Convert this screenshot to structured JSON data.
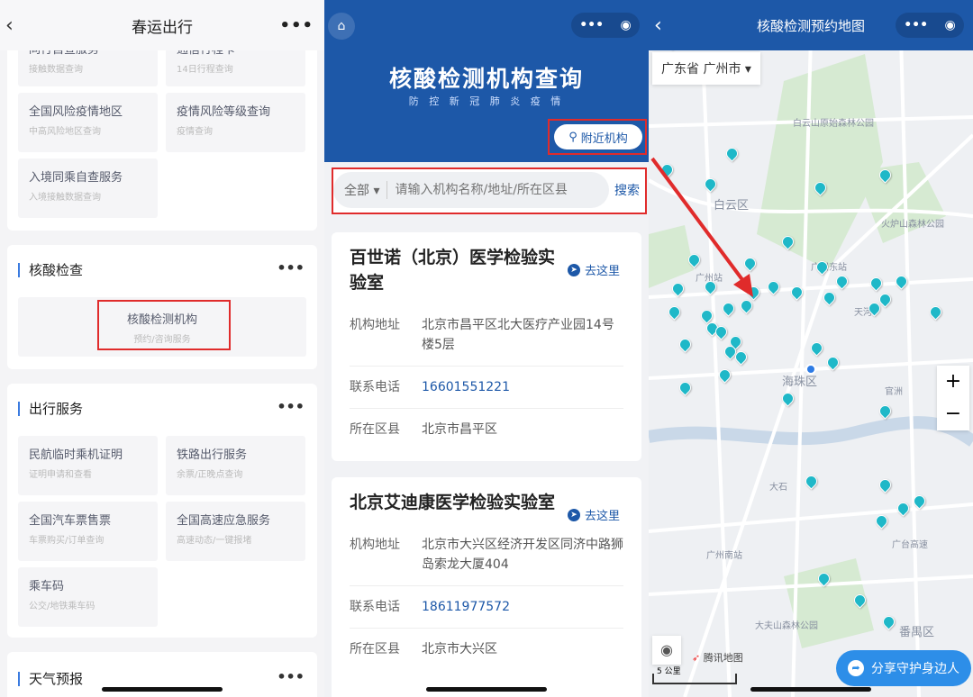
{
  "panel1": {
    "title": "春运出行",
    "top_tiles": [
      {
        "title": "同行自查服务",
        "sub": "接触数据查询"
      },
      {
        "title": "通信行程卡",
        "sub": "14日行程查询"
      },
      {
        "title": "全国风险疫情地区",
        "sub": "中高风险地区查询"
      },
      {
        "title": "疫情风险等级查询",
        "sub": "疫情查询"
      },
      {
        "title": "入境同乘自查服务",
        "sub": "入境接触数据查询"
      }
    ],
    "nat_section": {
      "title": "核酸检查",
      "tile": {
        "title": "核酸检测机构",
        "sub": "预约/咨询服务"
      }
    },
    "travel_section": {
      "title": "出行服务",
      "tiles": [
        {
          "title": "民航临时乘机证明",
          "sub": "证明申请和查看"
        },
        {
          "title": "铁路出行服务",
          "sub": "余票/正晚点查询"
        },
        {
          "title": "全国汽车票售票",
          "sub": "车票购买/订单查询"
        },
        {
          "title": "全国高速应急服务",
          "sub": "高速动态/一键报堵"
        },
        {
          "title": "乘车码",
          "sub": "公交/地铁乘车码"
        }
      ]
    },
    "weather_section": {
      "title": "天气预报"
    }
  },
  "panel2": {
    "title": "核酸检测机构查询",
    "subtitle": "防 控 新 冠 肺 炎 疫 情",
    "nearby_button": "附近机构",
    "filter": "全部",
    "search_placeholder": "请输入机构名称/地址/所在区县",
    "search_button": "搜索",
    "goto_label": "去这里",
    "labels": {
      "address": "机构地址",
      "phone": "联系电话",
      "district": "所在区县"
    },
    "institutions": [
      {
        "name": "百世诺（北京）医学检验实验室",
        "address": "北京市昌平区北大医疗产业园14号楼5层",
        "phone": "16601551221",
        "district": "北京市昌平区"
      },
      {
        "name": "北京艾迪康医学检验实验室",
        "address": "北京市大兴区经济开发区同济中路狮岛索龙大厦404",
        "phone": "18611977572",
        "district": "北京市大兴区"
      }
    ]
  },
  "panel3": {
    "title": "核酸检测预约地图",
    "region": "广东省 广州市",
    "map_labels": [
      "白云山原始森林公园",
      "白云区",
      "火炉山森林公园",
      "广州东站",
      "广州站",
      "天河",
      "海珠区",
      "官洲",
      "大石",
      "广台高速",
      "广州南站",
      "大夫山森林公园",
      "番禺区"
    ],
    "zoom_in": "+",
    "zoom_out": "−",
    "provider": "腾讯地图",
    "scale": "5 公里",
    "share_button": "分享守护身边人",
    "pin_color": "#1fb8c8",
    "user_color": "#2d7be5"
  },
  "colors": {
    "brand_blue": "#1d58a8",
    "highlight_red": "#e02b2b"
  }
}
